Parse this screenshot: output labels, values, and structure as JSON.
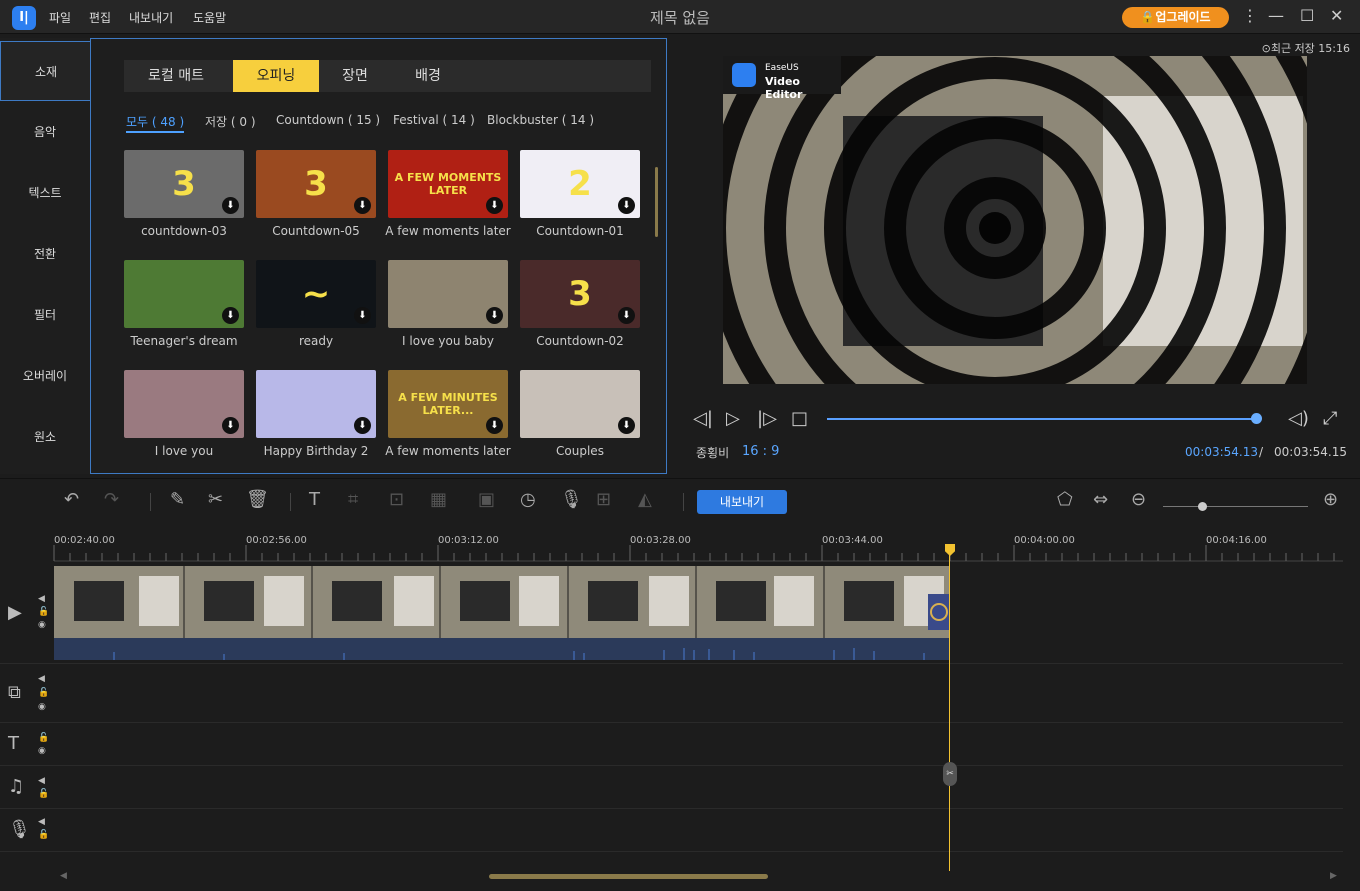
{
  "app": {
    "menu": [
      "파일",
      "편집",
      "내보내기",
      "도움말"
    ],
    "window_title": "제목 없음",
    "upgrade_label": "업그레이드",
    "logo_glyph": "I|",
    "controls": {
      "more": "⋮",
      "minimize": "—",
      "maximize": "☐",
      "close": "✕"
    }
  },
  "left_nav": {
    "items": [
      {
        "label": "소재",
        "active": true
      },
      {
        "label": "음악",
        "active": false
      },
      {
        "label": "텍스트",
        "active": false
      },
      {
        "label": "전환",
        "active": false
      },
      {
        "label": "필터",
        "active": false
      },
      {
        "label": "오버레이",
        "active": false
      },
      {
        "label": "원소",
        "active": false
      }
    ]
  },
  "media": {
    "tabs": [
      {
        "label": "로컬 매트",
        "active": false
      },
      {
        "label": "오피닝",
        "active": true
      },
      {
        "label": "장면",
        "active": false
      },
      {
        "label": "배경",
        "active": false
      }
    ],
    "filters": [
      {
        "label": "모두 ( 48 )",
        "active": true
      },
      {
        "label": "저장 ( 0 )",
        "active": false
      },
      {
        "label": "Countdown ( 15 )",
        "active": false
      },
      {
        "label": "Festival ( 14 )",
        "active": false
      },
      {
        "label": "Blockbuster ( 14 )",
        "active": false
      }
    ],
    "items": [
      {
        "label": "countdown-03",
        "color": "#6b6b6b",
        "overlay": "3"
      },
      {
        "label": "Countdown-05",
        "color": "#9a4a20",
        "overlay": "3"
      },
      {
        "label": "A few moments later",
        "color": "#b02014",
        "overlay": "A FEW MOMENTS LATER"
      },
      {
        "label": "Countdown-01",
        "color": "#f0eef5",
        "overlay": "2"
      },
      {
        "label": "Teenager's dream",
        "color": "#4e7a34",
        "overlay": ""
      },
      {
        "label": "ready",
        "color": "#101418",
        "overlay": "~"
      },
      {
        "label": "I love you baby",
        "color": "#8e8470",
        "overlay": ""
      },
      {
        "label": "Countdown-02",
        "color": "#4a2a2a",
        "overlay": "3"
      },
      {
        "label": "I love you",
        "color": "#9a7a80",
        "overlay": ""
      },
      {
        "label": "Happy Birthday 2",
        "color": "#b8b8e8",
        "overlay": ""
      },
      {
        "label": "A few moments later",
        "color": "#8a6a30",
        "overlay": "A FEW MINUTES LATER..."
      },
      {
        "label": "Couples",
        "color": "#c8c0b8",
        "overlay": ""
      }
    ],
    "download_glyph": "⬇"
  },
  "preview": {
    "last_saved": "⊙최근 저장 15:16",
    "badge_line1": "EaseUS",
    "badge_line2": "Video Editor",
    "aspect_label": "종횡비",
    "aspect_value": "16 : 9",
    "time_current": "00:03:54.13",
    "time_separator": "/",
    "time_total": "00:03:54.15",
    "progress_fraction": 1.0,
    "icons": {
      "prev": "◁|",
      "play": "▷",
      "next": "|▷",
      "stop": "□",
      "volume": "◁)",
      "fullscreen": "⤢"
    }
  },
  "toolbar": {
    "export_label": "내보내기",
    "tools": [
      {
        "name": "undo-icon",
        "glyph": "↶",
        "dim": false
      },
      {
        "name": "redo-icon",
        "glyph": "↷",
        "dim": true
      },
      {
        "name": "edit-pencil-icon",
        "glyph": "✎",
        "dim": false
      },
      {
        "name": "scissors-icon",
        "glyph": "✂",
        "dim": false
      },
      {
        "name": "trash-icon",
        "glyph": "🗑",
        "dim": false
      },
      {
        "name": "text-icon",
        "glyph": "T",
        "dim": false
      },
      {
        "name": "crop-icon",
        "glyph": "⌗",
        "dim": true
      },
      {
        "name": "zoom-frame-icon",
        "glyph": "⊡",
        "dim": true
      },
      {
        "name": "mosaic-icon",
        "glyph": "▦",
        "dim": true
      },
      {
        "name": "freeze-icon",
        "glyph": "▣",
        "dim": true
      },
      {
        "name": "speed-clock-icon",
        "glyph": "◷",
        "dim": false
      },
      {
        "name": "microphone-icon",
        "glyph": "🎙",
        "dim": false
      },
      {
        "name": "webcam-icon",
        "glyph": "⊞",
        "dim": true
      },
      {
        "name": "paint-bucket-icon",
        "glyph": "◭",
        "dim": true
      }
    ],
    "right_icons": {
      "marker": "⬠",
      "fit": "⇔",
      "zoom_out": "⊖",
      "zoom_in": "⊕"
    },
    "zoom_level": 0.27
  },
  "ruler": {
    "ticks": [
      "00:02:40.00",
      "00:02:56.00",
      "00:03:12.00",
      "00:03:28.00",
      "00:03:44.00",
      "00:04:00.00",
      "00:04:16.00"
    ]
  },
  "tracks": [
    {
      "name": "video",
      "glyph": "▶"
    },
    {
      "name": "overlay",
      "glyph": "⧉"
    },
    {
      "name": "text",
      "glyph": "T"
    },
    {
      "name": "music",
      "glyph": "♫"
    },
    {
      "name": "voice",
      "glyph": "🎙"
    }
  ],
  "track_controls": {
    "speaker": "◀",
    "lock": "🔓",
    "eye": "◉"
  },
  "splitter_glyph": "✂"
}
